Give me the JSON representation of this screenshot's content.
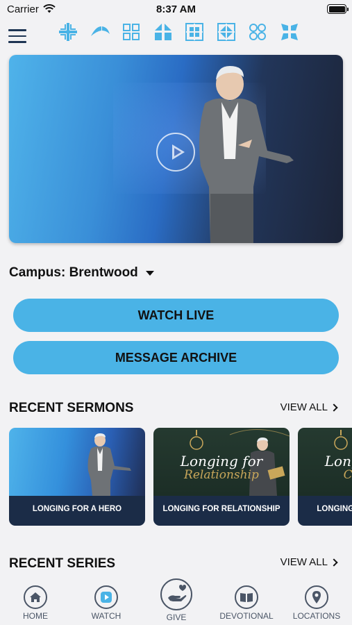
{
  "status_bar": {
    "carrier": "Carrier",
    "time": "8:37 AM"
  },
  "campus": {
    "label": "Campus: Brentwood"
  },
  "buttons": {
    "watch_live": "WATCH LIVE",
    "message_archive": "MESSAGE ARCHIVE"
  },
  "recent_sermons": {
    "title": "RECENT SERMONS",
    "view_all": "VIEW ALL",
    "cards": [
      {
        "caption": "LONGING FOR A HERO"
      },
      {
        "caption": "LONGING FOR RELATIONSHIP",
        "script_line1": "Longing for",
        "script_line2": "Relationship"
      },
      {
        "caption": "LONGING FOR CONTROL",
        "script_line1": "Longing for",
        "script_line2": "Control"
      }
    ]
  },
  "recent_series": {
    "title": "RECENT SERIES",
    "view_all": "VIEW ALL"
  },
  "tabbar": {
    "home": "HOME",
    "watch": "WATCH",
    "give": "GIVE",
    "devotional": "DEVOTIONAL",
    "locations": "LOCATIONS"
  },
  "colors": {
    "accent": "#4ab3e6",
    "brand_icon": "#4ab3e6",
    "card_caption_bg": "#1b2c47",
    "nav_icon": "#4a5566"
  },
  "icons": [
    "menu-icon",
    "brand-icon-1",
    "brand-icon-2",
    "brand-icon-3",
    "brand-icon-4",
    "brand-icon-5",
    "brand-icon-6",
    "brand-icon-7",
    "brand-icon-8",
    "play-icon",
    "home-icon",
    "watch-icon",
    "give-icon",
    "devotional-icon",
    "locations-icon"
  ]
}
